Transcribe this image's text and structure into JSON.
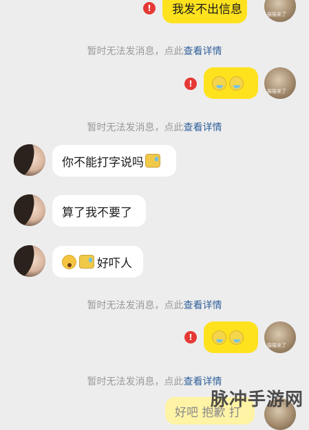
{
  "messages": [
    {
      "text": "我发不出信息",
      "direction": "out",
      "failed": true
    },
    {
      "notice": "暂时无法发消息，点此",
      "link": "查看详情"
    },
    {
      "emojis": [
        "sick-face",
        "sick-face"
      ],
      "direction": "out",
      "failed": true
    },
    {
      "notice": "暂时无法发消息，点此",
      "link": "查看详情"
    },
    {
      "text": "你不能打字说吗",
      "emoji": "sweat-face",
      "direction": "in"
    },
    {
      "text": "算了我不要了",
      "direction": "in"
    },
    {
      "emojis": [
        "scared-face",
        "sweat-face"
      ],
      "text": "好吓人",
      "direction": "in"
    },
    {
      "notice": "暂时无法发消息，点此",
      "link": "查看详情"
    },
    {
      "emojis": [
        "sick-face",
        "sick-face"
      ],
      "direction": "out",
      "failed": true
    },
    {
      "notice": "暂时无法发消息，点此",
      "link": "查看详情"
    },
    {
      "text": "好吧 抱歉 打",
      "direction": "out"
    }
  ],
  "avatar_tag": "猫猫来了",
  "error_glyph": "!",
  "watermark": "脉冲手游网",
  "colors": {
    "bubble_out": "#ffe21e",
    "bubble_in": "#ffffff",
    "link": "#2f5f9a",
    "error": "#e53935"
  }
}
